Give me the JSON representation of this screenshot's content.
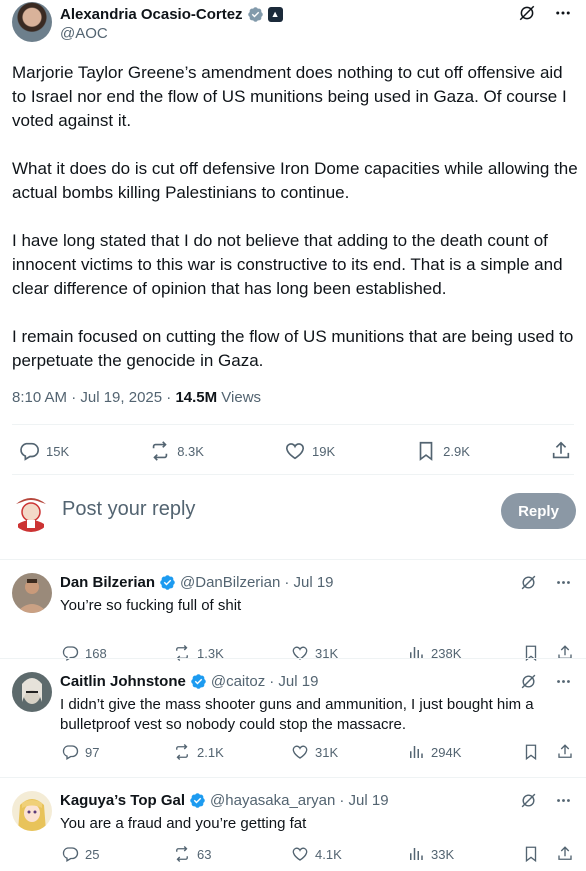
{
  "tweet": {
    "author_name": "Alexandria Ocasio-Cortez",
    "author_handle": "@AOC",
    "paragraphs": [
      "Marjorie Taylor Greene’s amendment does nothing to cut off offensive aid to Israel nor end the flow of US munitions being used in Gaza. Of course I voted against it.",
      "What it does do is cut off defensive Iron Dome capacities while allowing the actual bombs killing Palestinians to continue.",
      "I have long stated that I do not believe that adding to the death count of innocent victims to this war is constructive to its end. That is a simple and clear difference of opinion that has long been established.",
      "I remain focused on cutting the flow of US munitions that are being used to perpetuate the genocide in Gaza."
    ],
    "time": "8:10 AM · Jul 19, 2025 · ",
    "views_count": "14.5M",
    "views_label": " Views",
    "stats": {
      "replies": "15K",
      "reposts": "8.3K",
      "likes": "19K",
      "bookmarks": "2.9K"
    }
  },
  "composer": {
    "placeholder": "Post your reply",
    "reply_button": "Reply"
  },
  "replies": [
    {
      "name": "Dan Bilzerian",
      "handle": "@DanBilzerian",
      "date": "· Jul 19",
      "text": "You’re so fucking full of shit",
      "replies": "168",
      "reposts": "1.3K",
      "likes": "31K",
      "views": "238K"
    },
    {
      "name": "Caitlin Johnstone",
      "handle": "@caitoz",
      "date": "· Jul 19",
      "text": "I didn’t give the mass shooter guns and ammunition, I just bought him a bulletproof vest so nobody could stop the massacre.",
      "replies": "97",
      "reposts": "2.1K",
      "likes": "31K",
      "views": "294K"
    },
    {
      "name": "Kaguya’s Top Gal",
      "handle": "@hayasaka_aryan",
      "date": "· Jul 19",
      "text": "You are a fraud and you’re getting fat",
      "replies": "25",
      "reposts": "63",
      "likes": "4.1K",
      "views": "33K"
    }
  ],
  "colors": {
    "text": "#0f1419",
    "muted": "#536471",
    "verified": "#1d9bf0",
    "reply_button": "#8b98a5",
    "divider": "#eff3f4"
  },
  "icons": [
    "verified-badge-icon",
    "grok-icon",
    "more-icon",
    "reply-icon",
    "repost-icon",
    "like-icon",
    "bookmark-icon",
    "share-icon",
    "views-icon"
  ]
}
